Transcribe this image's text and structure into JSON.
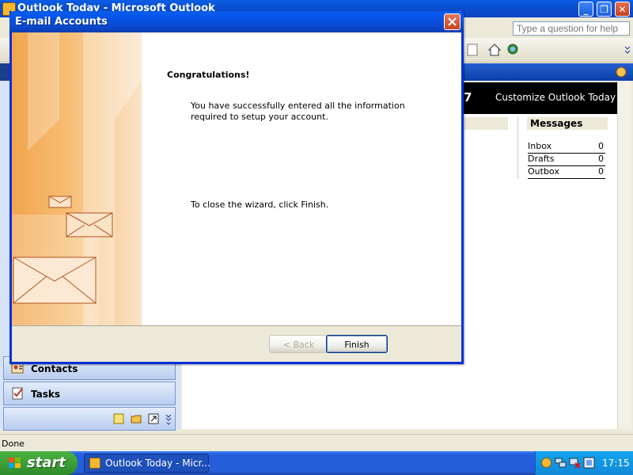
{
  "outlook": {
    "window_title": "Outlook Today - Microsoft Outlook",
    "help_placeholder": "Type a question for help",
    "date_fragment": "7",
    "customize_link": "Customize Outlook Today ...",
    "messages": {
      "title": "Messages",
      "rows": [
        {
          "label": "Inbox",
          "count": "0"
        },
        {
          "label": "Drafts",
          "count": "0"
        },
        {
          "label": "Outbox",
          "count": "0"
        }
      ]
    },
    "nav": {
      "contacts_label": "Contacts",
      "tasks_label": "Tasks"
    },
    "status_text": "Done"
  },
  "dialog": {
    "title": "E-mail Accounts",
    "heading": "Congratulations!",
    "message": "You have successfully entered all the information required to setup your account.",
    "close_note": "To close the wizard, click Finish.",
    "back_label": "< Back",
    "finish_label": "Finish"
  },
  "taskbar": {
    "start_label": "start",
    "task_item_label": "Outlook Today - Micr...",
    "clock": "17:15"
  },
  "colors": {
    "xp_blue": "#0a5ee6",
    "start_green": "#3a9c35",
    "tray_blue": "#0f8ad9",
    "dialog_art_orange": "#f1a044"
  }
}
